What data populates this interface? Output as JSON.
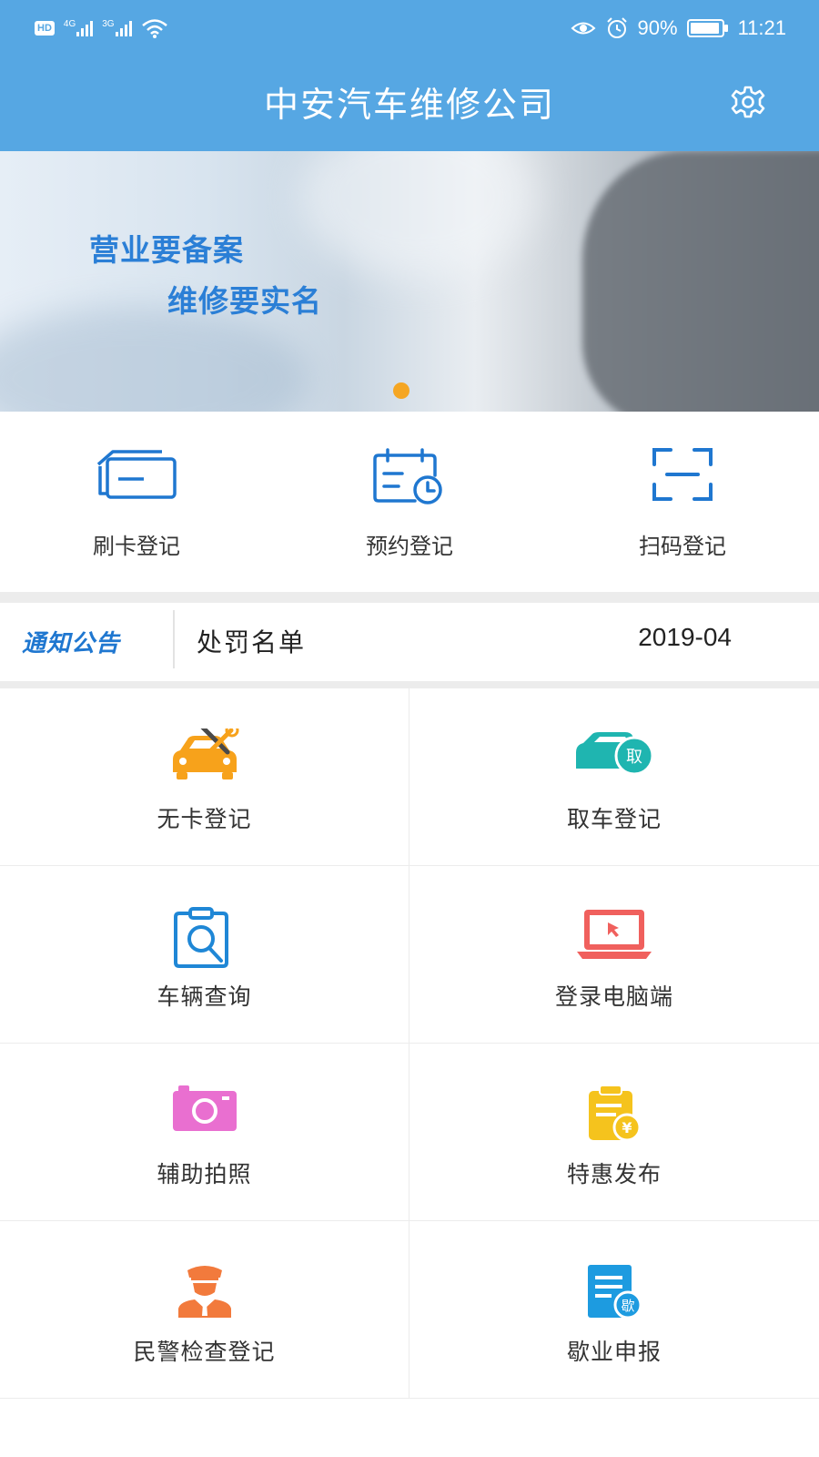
{
  "status_bar": {
    "hd": "HD",
    "net1": "4G",
    "net2": "3G",
    "battery": "90%",
    "time": "11:21"
  },
  "app_bar": {
    "title": "中安汽车维修公司",
    "settings_icon": "gear-icon"
  },
  "banner": {
    "line1": "营业要备案",
    "line2": "维修要实名",
    "page_indicator_active_color": "#f5a623"
  },
  "quick_actions": [
    {
      "label": "刷卡登记",
      "icon": "card-icon"
    },
    {
      "label": "预约登记",
      "icon": "calendar-clock-icon"
    },
    {
      "label": "扫码登记",
      "icon": "scan-icon"
    }
  ],
  "notice": {
    "tag": "通知公告",
    "text": "处罚名单",
    "date": "2019-04"
  },
  "menu": [
    {
      "label": "无卡登记",
      "icon": "car-repair-icon",
      "color": "#f7a21b"
    },
    {
      "label": "取车登记",
      "icon": "car-pickup-icon",
      "color": "#1fb5b0"
    },
    {
      "label": "车辆查询",
      "icon": "clipboard-search-icon",
      "color": "#1f87d6"
    },
    {
      "label": "登录电脑端",
      "icon": "laptop-icon",
      "color": "#f0605d"
    },
    {
      "label": "辅助拍照",
      "icon": "camera-icon",
      "color": "#e96fd0"
    },
    {
      "label": "特惠发布",
      "icon": "clipboard-yuan-icon",
      "color": "#f5c31d"
    },
    {
      "label": "民警检查登记",
      "icon": "police-icon",
      "color": "#f27a3c"
    },
    {
      "label": "歇业申报",
      "icon": "document-badge-icon",
      "color": "#1d9be0"
    }
  ],
  "menu_badges": {
    "pickup": "取",
    "suspend": "歇",
    "yuan": "¥"
  },
  "colors": {
    "primary": "#56a7e3",
    "icon_blue": "#1f77d0",
    "notice_tag": "#1f77d0"
  }
}
